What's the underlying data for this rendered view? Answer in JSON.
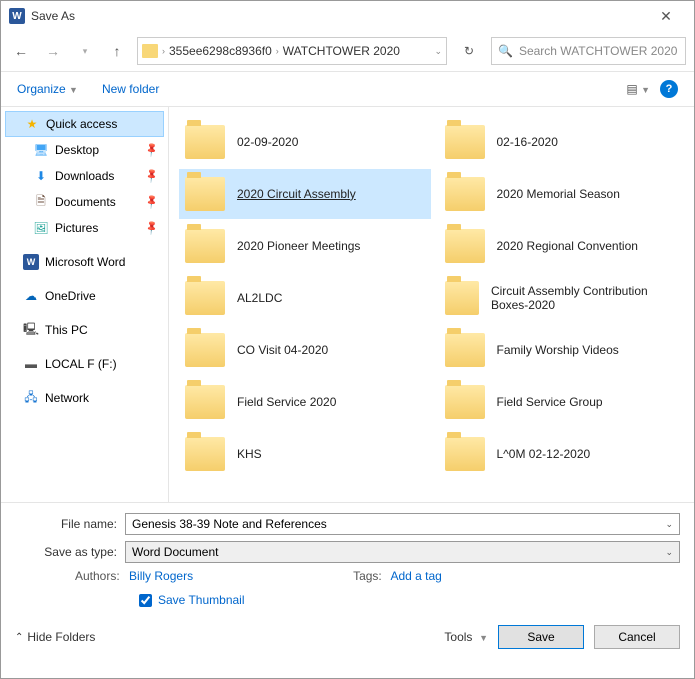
{
  "title": "Save As",
  "breadcrumb": {
    "seg1": "355ee6298c8936f0",
    "seg2": "WATCHTOWER 2020"
  },
  "search": {
    "placeholder": "Search WATCHTOWER 2020"
  },
  "toolbar": {
    "organize": "Organize",
    "newfolder": "New folder"
  },
  "sidebar": {
    "quick": "Quick access",
    "desktop": "Desktop",
    "downloads": "Downloads",
    "documents": "Documents",
    "pictures": "Pictures",
    "word": "Microsoft Word",
    "onedrive": "OneDrive",
    "thispc": "This PC",
    "localf": "LOCAL F (F:)",
    "network": "Network"
  },
  "folders": [
    {
      "name": "02-09-2020"
    },
    {
      "name": "02-16-2020"
    },
    {
      "name": "2020 Circuit Assembly",
      "selected": true
    },
    {
      "name": "2020 Memorial Season"
    },
    {
      "name": "2020 Pioneer Meetings"
    },
    {
      "name": "2020 Regional Convention"
    },
    {
      "name": "AL2LDC"
    },
    {
      "name": "Circuit Assembly Contribution Boxes-2020"
    },
    {
      "name": "CO Visit 04-2020"
    },
    {
      "name": "Family Worship Videos"
    },
    {
      "name": "Field Service 2020"
    },
    {
      "name": "Field Service Group"
    },
    {
      "name": "KHS"
    },
    {
      "name": "L^0M 02-12-2020"
    }
  ],
  "filename_label": "File name:",
  "filename_value": "Genesis 38-39 Note and References",
  "savetype_label": "Save as type:",
  "savetype_value": "Word Document",
  "authors_label": "Authors:",
  "authors_value": "Billy Rogers",
  "tags_label": "Tags:",
  "tags_value": "Add a tag",
  "save_thumbnail": "Save Thumbnail",
  "hide_folders": "Hide Folders",
  "tools": "Tools",
  "save": "Save",
  "cancel": "Cancel"
}
